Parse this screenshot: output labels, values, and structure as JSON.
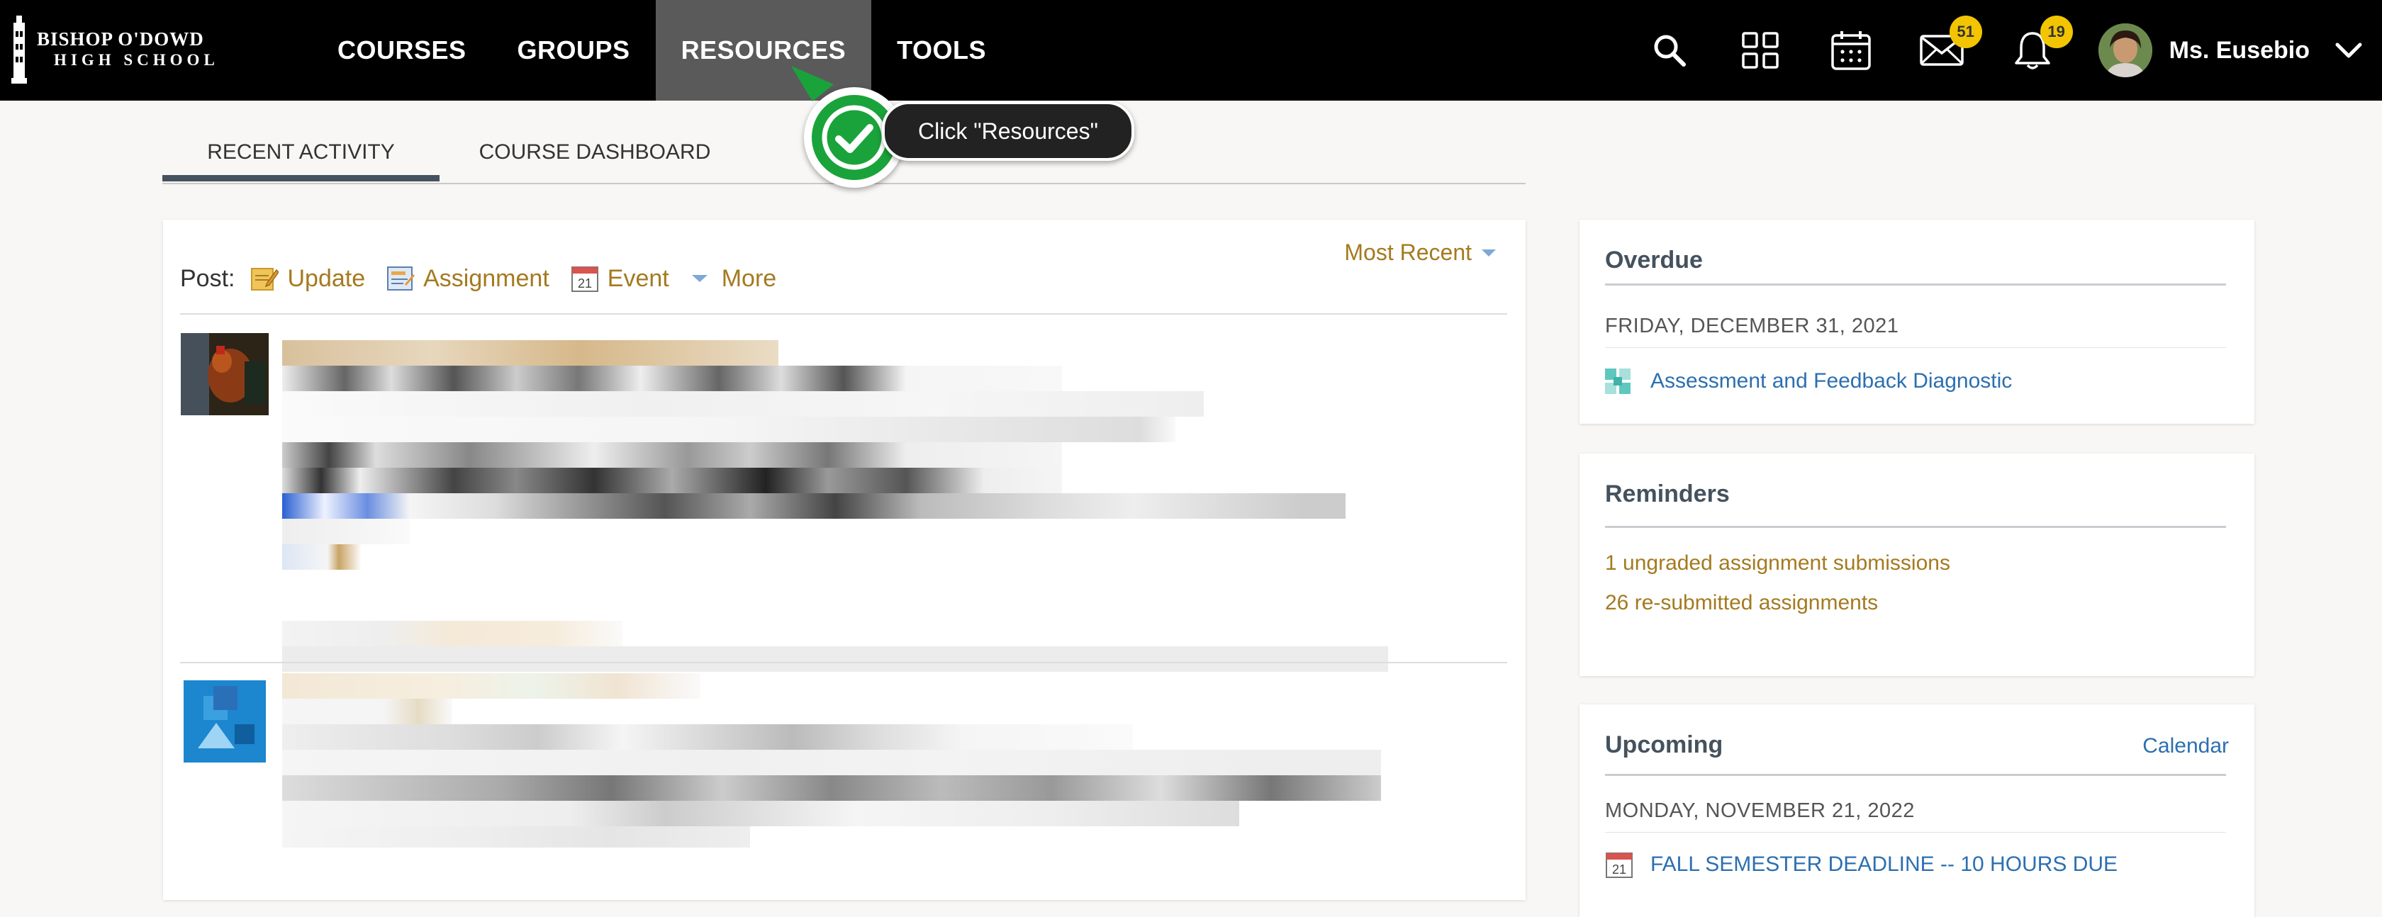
{
  "logo": {
    "line1": "BISHOP O'DOWD",
    "line2": "HIGH SCHOOL"
  },
  "nav": {
    "items": [
      {
        "label": "COURSES"
      },
      {
        "label": "GROUPS"
      },
      {
        "label": "RESOURCES"
      },
      {
        "label": "TOOLS"
      }
    ],
    "active_index": 2,
    "icons": [
      "search-icon",
      "apps-grid-icon",
      "calendar-icon",
      "mail-icon",
      "bell-icon"
    ],
    "mail_badge": "51",
    "notification_badge": "19",
    "user_name": "Ms. Eusebio"
  },
  "tabs": [
    {
      "label": "RECENT ACTIVITY"
    },
    {
      "label": "COURSE DASHBOARD"
    }
  ],
  "tooltip": {
    "text": "Click \"Resources\""
  },
  "feed": {
    "post_label": "Post:",
    "options": [
      {
        "label": "Update",
        "icon": "update-icon"
      },
      {
        "label": "Assignment",
        "icon": "assignment-icon"
      },
      {
        "label": "Event",
        "icon": "event-calendar-icon",
        "icon_text": "21"
      },
      {
        "label": "More",
        "icon": "caret-down-icon"
      }
    ],
    "sort_label": "Most Recent"
  },
  "sidebar": {
    "overdue": {
      "title": "Overdue",
      "date": "FRIDAY, DECEMBER 31, 2021",
      "item": "Assessment and Feedback Diagnostic"
    },
    "reminders": {
      "title": "Reminders",
      "items": [
        "1 ungraded assignment submissions",
        "26 re-submitted assignments"
      ]
    },
    "upcoming": {
      "title": "Upcoming",
      "calendar_link": "Calendar",
      "date": "MONDAY, NOVEMBER 21, 2022",
      "item": "FALL SEMESTER DEADLINE -- 10 HOURS DUE",
      "item_icon_text": "21"
    }
  },
  "colors": {
    "topbar": "#000000",
    "nav_active": "#5a5a5a",
    "badge": "#f2c500",
    "gold_link": "#a47a1f",
    "blue_link": "#2c6fb0",
    "tooltip_check": "#1aa33a"
  }
}
